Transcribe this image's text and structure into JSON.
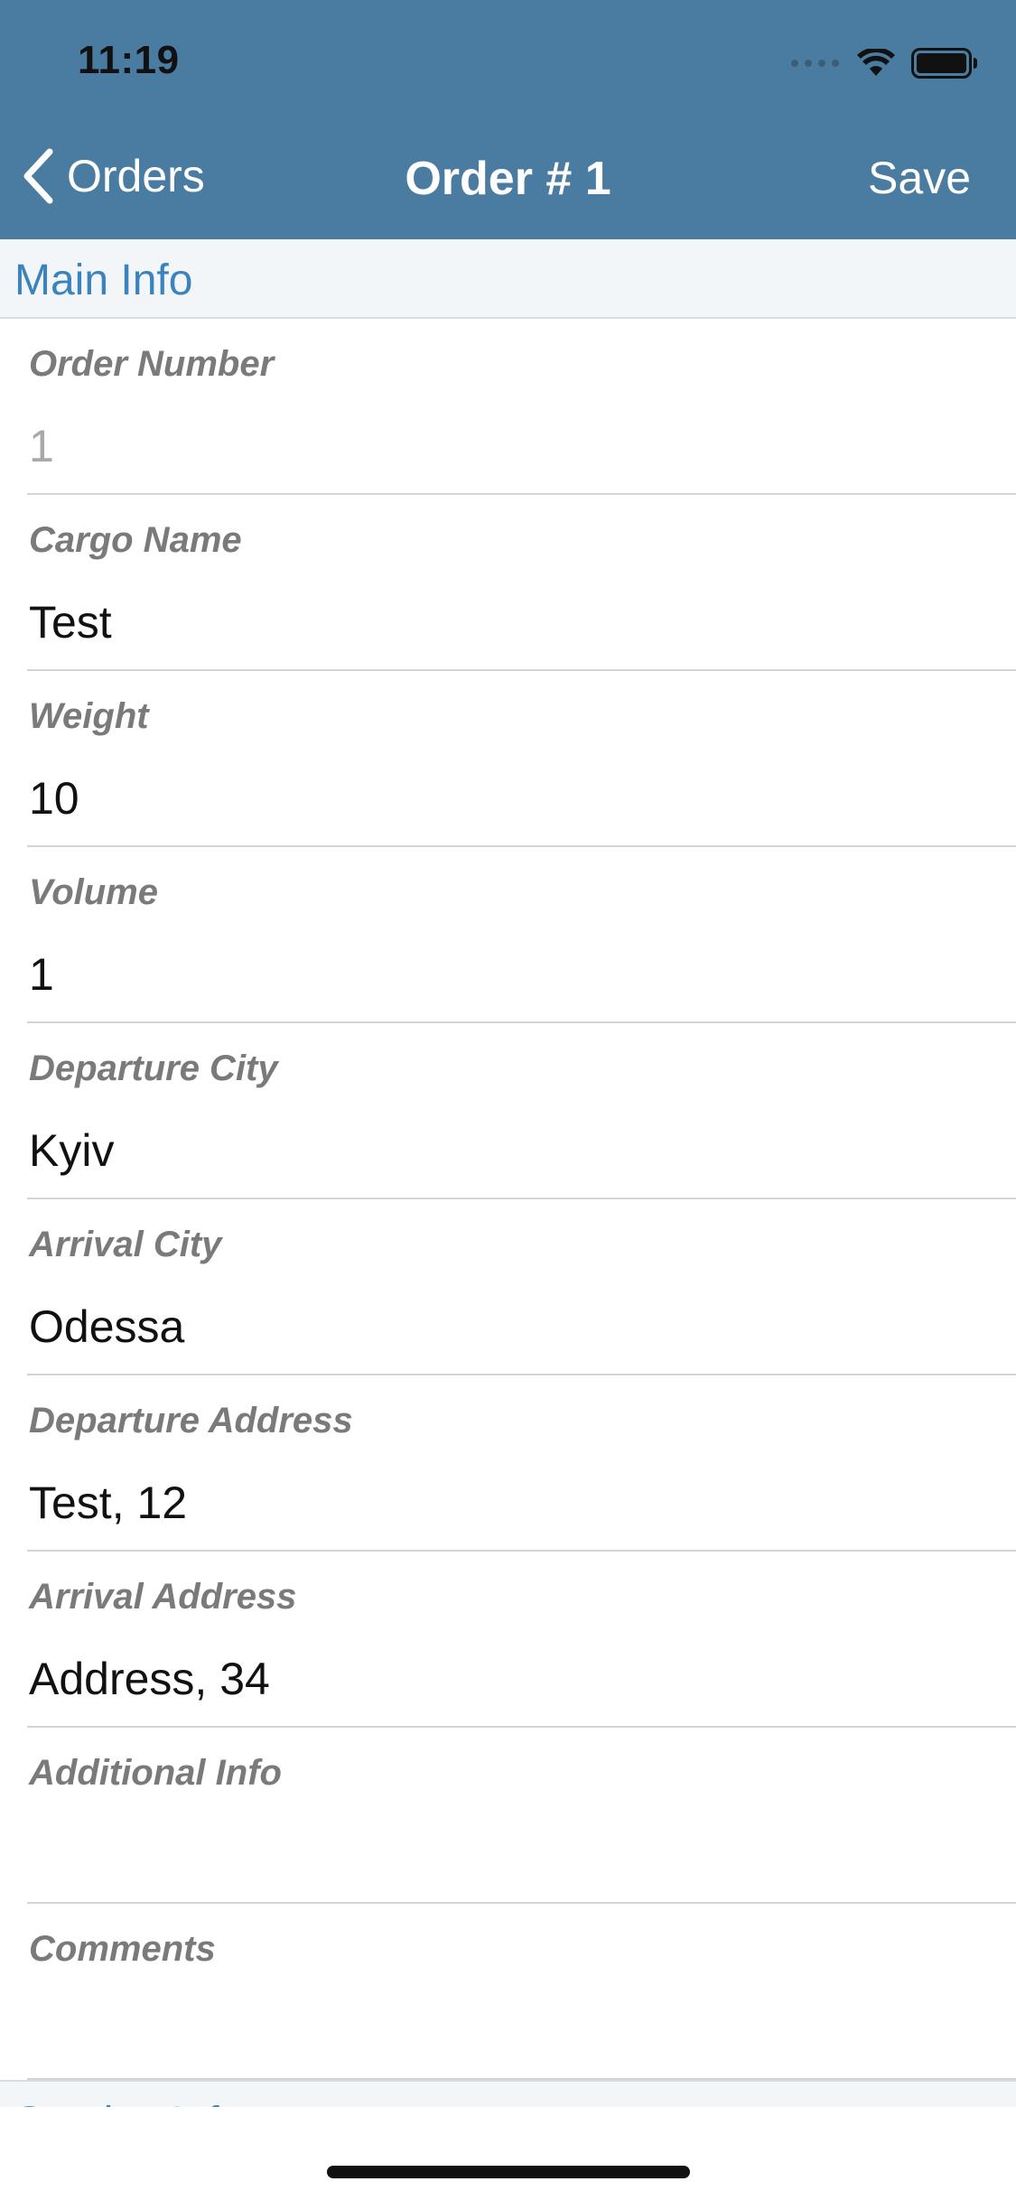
{
  "status_bar": {
    "time": "11:19"
  },
  "nav": {
    "back_label": "Orders",
    "title": "Order # 1",
    "save_label": "Save"
  },
  "section": {
    "title": "Main Info"
  },
  "fields": [
    {
      "label": "Order Number",
      "value": "1"
    },
    {
      "label": "Cargo Name",
      "value": "Test"
    },
    {
      "label": "Weight",
      "value": "10"
    },
    {
      "label": "Volume",
      "value": "1"
    },
    {
      "label": "Departure City",
      "value": "Kyiv"
    },
    {
      "label": "Arrival City",
      "value": "Odessa"
    },
    {
      "label": "Departure Address",
      "value": "Test, 12"
    },
    {
      "label": "Arrival Address",
      "value": "Address, 34"
    },
    {
      "label": "Additional Info",
      "value": ""
    },
    {
      "label": "Comments",
      "value": ""
    }
  ],
  "next_section": {
    "title": "Service Info"
  },
  "colors": {
    "nav_background": "#4a7ca1",
    "section_title": "#3b83bd",
    "label": "#7a7a7a"
  }
}
